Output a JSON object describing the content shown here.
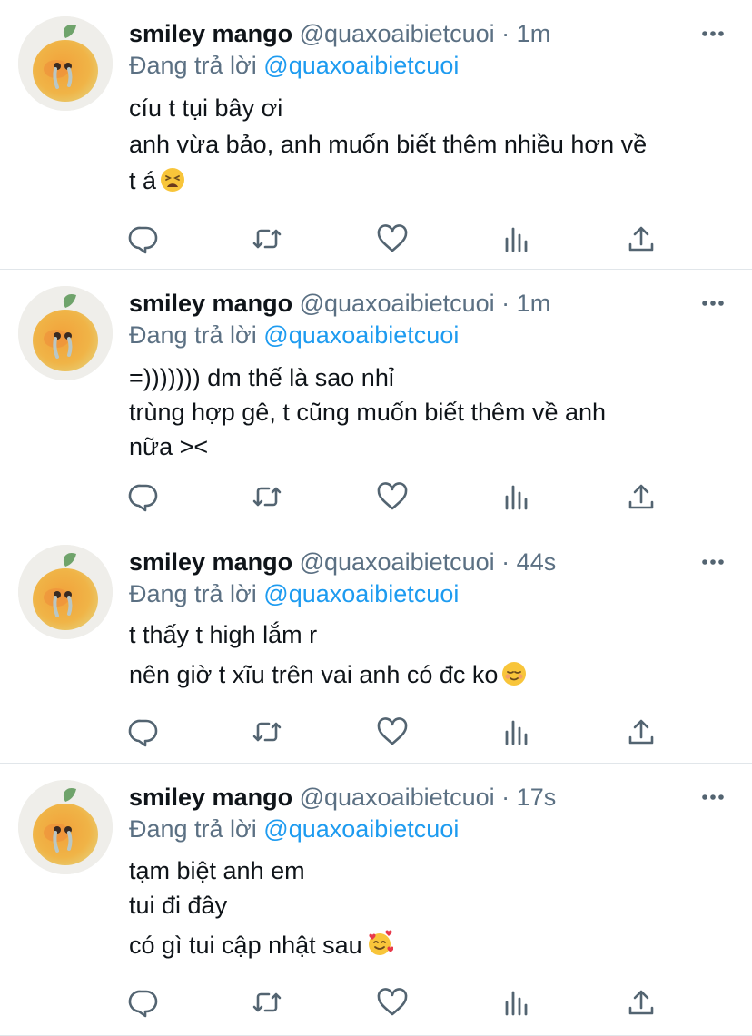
{
  "tweets": [
    {
      "name": "smiley mango",
      "handle": "@quaxoaibietcuoi",
      "separator": "·",
      "time": "1m",
      "reply_prefix": "Đang trả lời",
      "reply_to": "@quaxoaibietcuoi",
      "lines": [
        "cíu t tụi bây ơi",
        "anh vừa bảo, anh muốn biết thêm nhiều hơn về",
        "t á"
      ],
      "emoji": "tired-face-emoji"
    },
    {
      "name": "smiley mango",
      "handle": "@quaxoaibietcuoi",
      "separator": "·",
      "time": "1m",
      "reply_prefix": "Đang trả lời",
      "reply_to": "@quaxoaibietcuoi",
      "lines": [
        "=))))))) dm thế là sao nhỉ",
        "trùng hợp gê, t cũng muốn biết thêm về anh",
        "nữa ><"
      ]
    },
    {
      "name": "smiley mango",
      "handle": "@quaxoaibietcuoi",
      "separator": "·",
      "time": "44s",
      "reply_prefix": "Đang trả lời",
      "reply_to": "@quaxoaibietcuoi",
      "lines": [
        "t thấy t high lắm r",
        "nên giờ t xĩu trên vai anh có đc ko"
      ],
      "emoji": "relieved-face-emoji"
    },
    {
      "name": "smiley mango",
      "handle": "@quaxoaibietcuoi",
      "separator": "·",
      "time": "17s",
      "reply_prefix": "Đang trả lời",
      "reply_to": "@quaxoaibietcuoi",
      "lines": [
        "tạm biệt anh em",
        "tui đi đây",
        "có gì tui cập nhật sau"
      ],
      "emoji": "smiling-face-with-hearts-emoji"
    }
  ],
  "colors": {
    "name": "#0f1419",
    "meta": "#5b7083",
    "link": "#1d9bf0",
    "icon": "#536471",
    "divider": "#e1e6ea"
  },
  "icons": [
    "more-icon",
    "reply-icon",
    "retweet-icon",
    "like-icon",
    "analytics-icon",
    "share-icon"
  ]
}
